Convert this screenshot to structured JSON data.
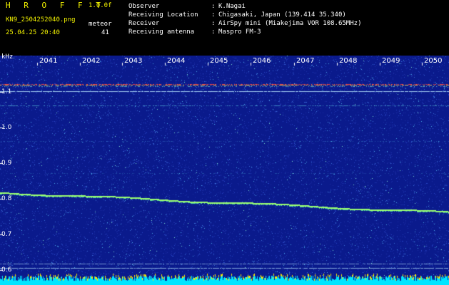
{
  "header": {
    "app_name": "H R O F F T",
    "version": "1.0.0f",
    "filename": "KN9_2504252040.png",
    "datetime": "25.04.25 20:40",
    "meteor_label": "meteor",
    "meteor_count": "41",
    "observer_label": "Observer",
    "observer_value": "K.Nagai",
    "location_label": "Receiving Location",
    "location_value": "Chigasaki, Japan (139.414 35.340)",
    "receiver_label": "Receiver",
    "receiver_value": "AirSpy mini (Miakejima VOR 108.65MHz)",
    "antenna_label": "Receiving antenna",
    "antenna_value": "Maspro FM-3",
    "separator": ":"
  },
  "axis": {
    "unit": "kHz",
    "y_ticks": [
      "1.1",
      "1.0",
      "0.9",
      "0.8",
      "0.7",
      "0.6"
    ],
    "x_ticks": [
      "2041",
      "2042",
      "2043",
      "2044",
      "2045",
      "2046",
      "2047",
      "2048",
      "2049",
      "2050"
    ]
  },
  "colors": {
    "background": "#0a1a8c",
    "signal": "#9cff70",
    "carrier": "#ff4040",
    "baseline": "#00e5ff",
    "label": "#ffffff",
    "title": "#f2f200"
  }
}
